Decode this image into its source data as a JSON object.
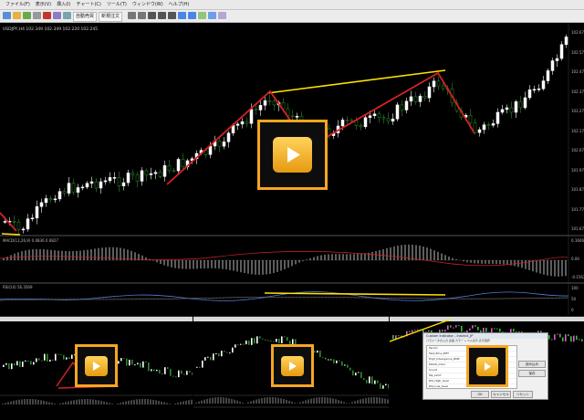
{
  "menubar": [
    "ファイル(F)",
    "表示(V)",
    "挿入(I)",
    "チャート(C)",
    "ツール(T)",
    "ウィンドウ(W)",
    "ヘルプ(H)"
  ],
  "toolbar": {
    "auto_trade": "自動売買",
    "new_order": "新規注文"
  },
  "chart": {
    "symbol_label": "USDJPY,H4 102.349 102.349 102.220 102.245",
    "price_ticks": [
      "102.675",
      "102.575",
      "102.475",
      "102.375",
      "102.275",
      "102.175",
      "102.075",
      "101.975",
      "101.875",
      "101.775",
      "101.675"
    ],
    "macd_label": "MACD(12,26,9) 0.0836 0.0827",
    "macd_ticks": [
      "0.1606",
      "0.00",
      "-0.1563"
    ],
    "rsi_label": "RSI(14) 56.3569",
    "rsi_ticks": [
      "100",
      "50",
      "0"
    ],
    "colors": {
      "up": "#ffffff",
      "down": "#2e8b2e",
      "trendline": "#d42222",
      "upper_line": "#ffe000",
      "play_border": "#f5a623"
    }
  },
  "dialog": {
    "title": "Custom Indicator - Instinct_JP",
    "tabs": "パラメータの入力 全般 カラー レベル表示 表示選択",
    "params": [
      "Period",
      "Fast_Ema_PMT",
      "High_Divergence_RMP",
      "MACD_Color",
      "Count",
      "Ma_Limit",
      "RSI_High_level",
      "RSI_Low_level"
    ],
    "ok": "OK",
    "cancel": "キャンセル",
    "reset": "リセット",
    "load": "読み込み",
    "save": "保存"
  },
  "play_icon": "play-button-icon"
}
